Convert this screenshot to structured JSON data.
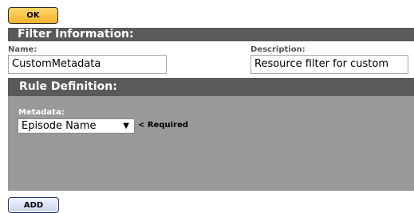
{
  "toolbar": {
    "ok_label": "OK"
  },
  "filter_info": {
    "title": "Filter Information:",
    "name_label": "Name:",
    "name_value": "CustomMetadata",
    "description_label": "Description:",
    "description_value": "Resource filter for custom"
  },
  "rule_definition": {
    "title": "Rule Definition:",
    "metadata_label": "Metadata:",
    "metadata_selected": "Episode Name",
    "dropdown_icon": "triangle-down",
    "required_note": "< Required"
  },
  "footer": {
    "add_label": "ADD"
  },
  "colors": {
    "section_bar": "#5a5a5a",
    "panel_bg": "#9a9a9a",
    "ok_button": "#f6b42e",
    "add_button": "#c9d4ec"
  }
}
